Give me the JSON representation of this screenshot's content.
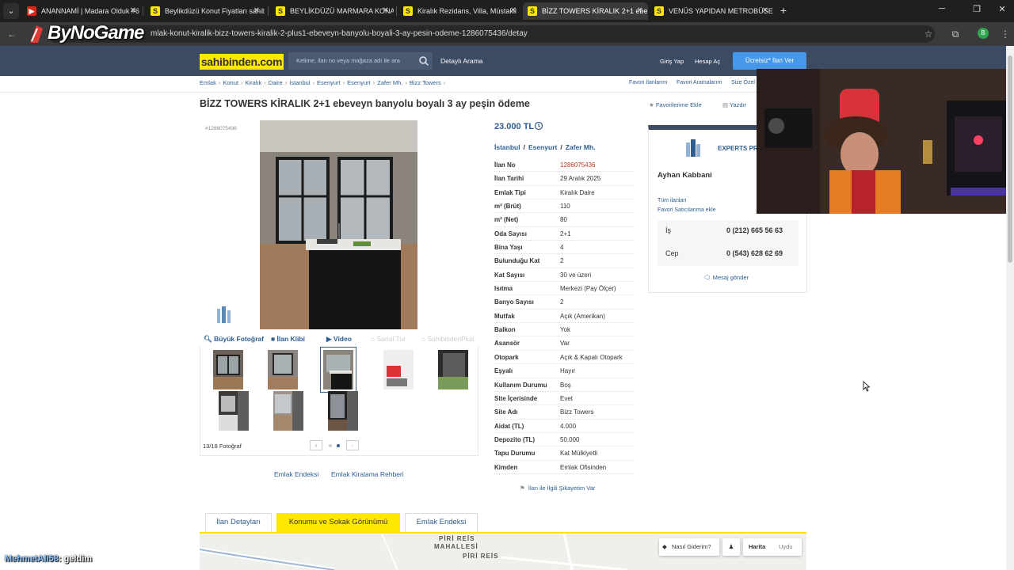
{
  "browser": {
    "tabs": [
      {
        "title": "ANANNAMİ | Madara Olduk #6",
        "favicon": "yt"
      },
      {
        "title": "Beylikdüzü Konut Fiyatları sahib",
        "favicon": "sb"
      },
      {
        "title": "BEYLİKDÜZÜ MARMARA KONA",
        "favicon": "sb"
      },
      {
        "title": "Kiralık Rezidans, Villa, Müstakil",
        "favicon": "sb"
      },
      {
        "title": "BİZZ TOWERS KİRALIK 2+1 ebe",
        "favicon": "sb"
      },
      {
        "title": "VENÜS YAPIDAN METROBÜSE Y",
        "favicon": "sb"
      }
    ],
    "url": "mlak-konut-kiralik-bizz-towers-kiralik-2-plus1-ebeveyn-banyolu-boyali-3-ay-pesin-odeme-1286075436/detay",
    "profile_initial": "B"
  },
  "overlay": {
    "brand": "ByNoGame",
    "chat_user": "MehmetAli58",
    "chat_message": ": geldim"
  },
  "header": {
    "logo": "sahibinden.com",
    "search_placeholder": "Kelime, ilan no veya mağaza adı ile ara",
    "advanced_search": "Detaylı Arama",
    "login": "Giriş Yap",
    "register": "Hesap Aç",
    "cta": "Ücretsiz* İlan Ver"
  },
  "breadcrumb": [
    "Emlak",
    "Konut",
    "Kiralık",
    "Daire",
    "İstanbul",
    "Esenyurt",
    "Esenyurt",
    "Zafer Mh.",
    "Bizz Towers"
  ],
  "breadcrumb_right": [
    "Favori İlanlarım",
    "Favori Aramalarım",
    "Size Özel"
  ],
  "listing": {
    "title": "BİZZ TOWERS KİRALIK 2+1 ebeveyn banyolu boyalı 3 ay peşin ödeme",
    "add_favorite": "Favorilerime Ekle",
    "print": "Yazdır",
    "listing_no_small": "#1286075436",
    "price": "23.000 TL",
    "location": [
      "İstanbul",
      "Esenyurt",
      "Zafer Mh."
    ],
    "details": [
      {
        "k": "İlan No",
        "v": "1286075436",
        "red": true
      },
      {
        "k": "İlan Tarihi",
        "v": "29 Aralık 2025"
      },
      {
        "k": "Emlak Tipi",
        "v": "Kiralık Daire"
      },
      {
        "k": "m² (Brüt)",
        "v": "110"
      },
      {
        "k": "m² (Net)",
        "v": "80"
      },
      {
        "k": "Oda Sayısı",
        "v": "2+1"
      },
      {
        "k": "Bina Yaşı",
        "v": "4"
      },
      {
        "k": "Bulunduğu Kat",
        "v": "2"
      },
      {
        "k": "Kat Sayısı",
        "v": "30 ve üzeri"
      },
      {
        "k": "Isıtma",
        "v": "Merkezi (Pay Ölçer)"
      },
      {
        "k": "Banyo Sayısı",
        "v": "2"
      },
      {
        "k": "Mutfak",
        "v": "Açık (Amerikan)"
      },
      {
        "k": "Balkon",
        "v": "Yok"
      },
      {
        "k": "Asansör",
        "v": "Var"
      },
      {
        "k": "Otopark",
        "v": "Açık & Kapalı Otopark"
      },
      {
        "k": "Eşyalı",
        "v": "Hayır"
      },
      {
        "k": "Kullanım Durumu",
        "v": "Boş"
      },
      {
        "k": "Site İçerisinde",
        "v": "Evet"
      },
      {
        "k": "Site Adı",
        "v": "Bizz Towers"
      },
      {
        "k": "Aidat (TL)",
        "v": "4.000"
      },
      {
        "k": "Depozito (TL)",
        "v": "50.000"
      },
      {
        "k": "Tapu Durumu",
        "v": "Kat Mülkiyetli"
      },
      {
        "k": "Kimden",
        "v": "Emlak Ofisinden"
      }
    ],
    "complaint": "İlan ile İlgili Şikayetim Var"
  },
  "photos": {
    "actions": {
      "big_photo": "Büyük Fotoğraf",
      "clip": "İlan Klibi",
      "video": "Video",
      "virtual_tour": "Sanal Tur",
      "sahibinden360": "SahibindenPlus"
    },
    "count": "13/18 Fotoğraf",
    "bottom_links": [
      "Emlak Endeksi",
      "Emlak Kiralama Rehberi"
    ]
  },
  "seller": {
    "brand": "EXPERTS PRO",
    "name": "Ayhan Kabbani",
    "all_listings": "Tüm ilanları",
    "add_favorite_seller": "Favori Satıcılarıma ekle",
    "phones": [
      {
        "label": "İş",
        "number": "0 (212) 665 56 63"
      },
      {
        "label": "Cep",
        "number": "0 (543) 628 62 69"
      }
    ],
    "message": "Mesaj gönder"
  },
  "bottom_tabs": [
    "İlan Detayları",
    "Konumu ve Sokak Görünümü",
    "Emlak Endeksi"
  ],
  "map": {
    "labels": [
      "PİRİ REİS",
      "MAHALLESİ",
      "PİRİ REİS"
    ],
    "directions": "Nasıl Giderim?",
    "map_mode": "Harita",
    "satellite_mode": "Uydu"
  },
  "colors": {
    "brand_yellow": "#ffe800",
    "header_navy": "#3b4b63",
    "link_blue": "#2d5d91",
    "cta_blue": "#4597e8"
  }
}
